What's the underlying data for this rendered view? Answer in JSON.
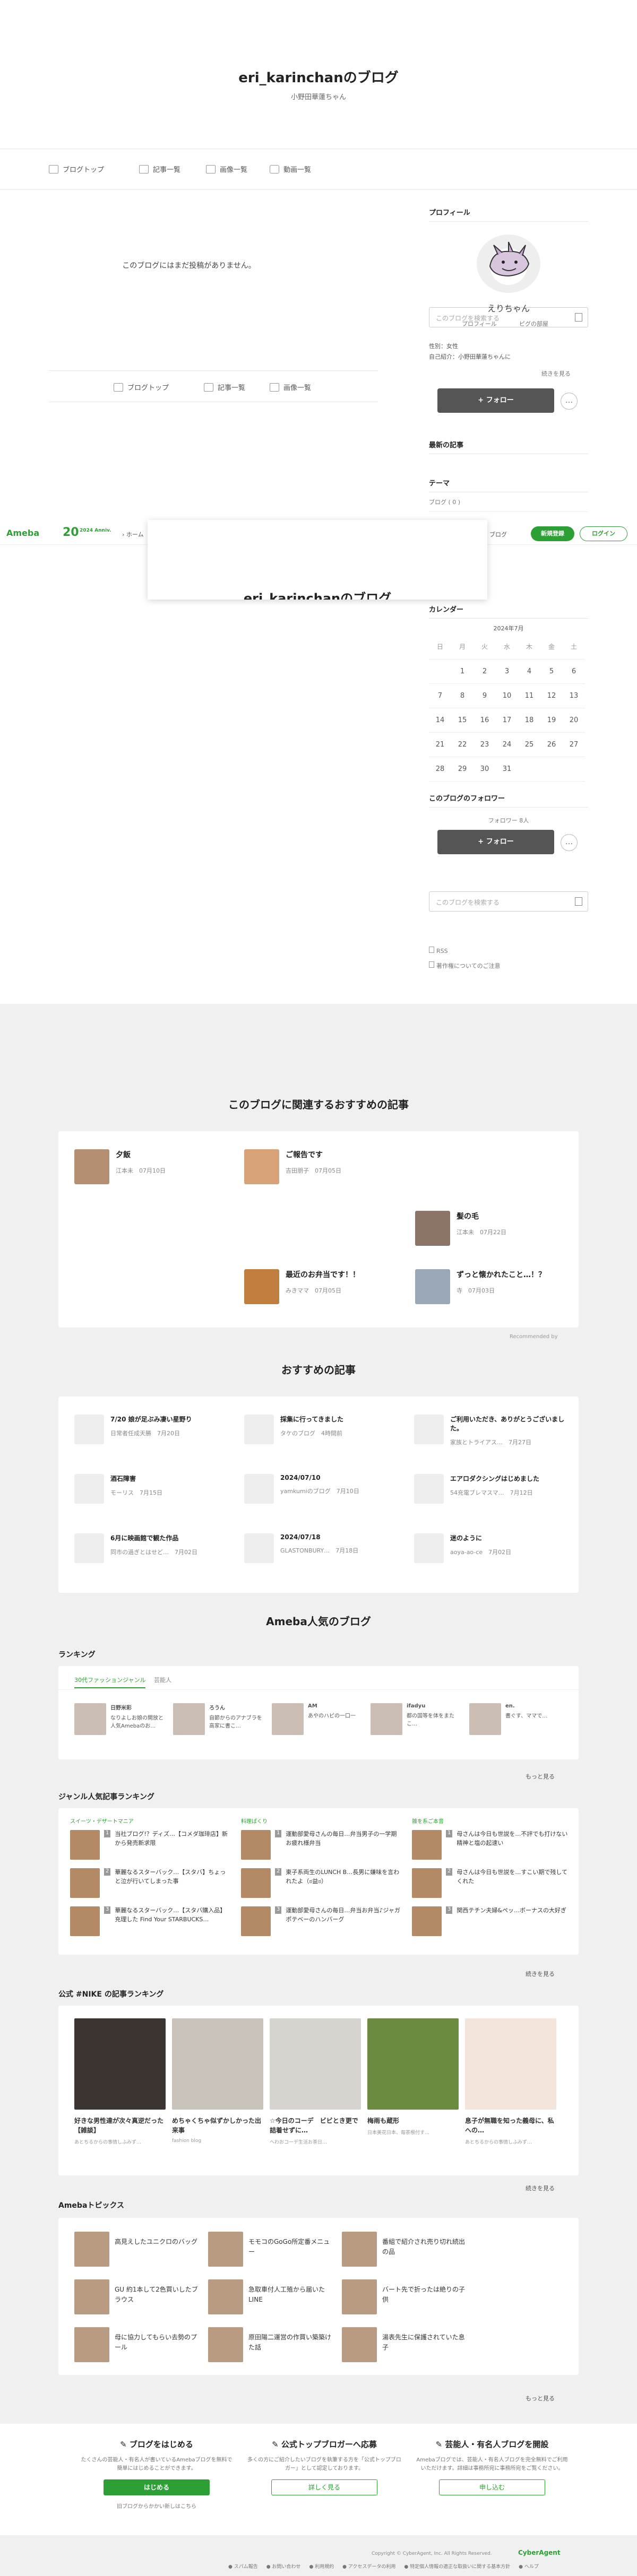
{
  "blog": {
    "title": "eri_karinchanのブログ",
    "subtitle": "小野田華蓮ちゃん"
  },
  "nav": {
    "items": [
      "ブログトップ",
      "記事一覧",
      "画像一覧",
      "動画一覧"
    ],
    "search_placeholder": "このブログを検索する"
  },
  "main": {
    "empty": "このブログにはまだ投稿がありません。",
    "subnav": [
      "ブログトップ",
      "記事一覧",
      "画像一覧"
    ]
  },
  "ameba_bar": {
    "logo": "Ameba",
    "anniv": "20",
    "anniv_sub": "2024 Anniv.",
    "home": "ホーム",
    "myblog": "ブログ",
    "register": "新規登録",
    "login": "ログイン",
    "overlay_title": "eri_karinchanのブログ"
  },
  "side": {
    "profile": {
      "title": "プロフィール",
      "name": "えりちゃん",
      "links": [
        "プロフィール",
        "ピグの部屋"
      ],
      "gender": "性別：女性",
      "intro": "自己紹介：小野田華蓮ちゃんに",
      "more": "続きを見る",
      "follow": "+ フォロー",
      "more_icon": "…"
    },
    "latest": {
      "title": "最新の記事"
    },
    "theme": {
      "title": "テーマ",
      "item": "ブログ ( 0 )"
    },
    "calendar": {
      "title": "カレンダー",
      "month": "2024年7月",
      "days": [
        "日",
        "月",
        "火",
        "水",
        "木",
        "金",
        "土"
      ],
      "weeks": [
        [
          "",
          "1",
          "2",
          "3",
          "4",
          "5",
          "6"
        ],
        [
          "7",
          "8",
          "9",
          "10",
          "11",
          "12",
          "13"
        ],
        [
          "14",
          "15",
          "16",
          "17",
          "18",
          "19",
          "20"
        ],
        [
          "21",
          "22",
          "23",
          "24",
          "25",
          "26",
          "27"
        ],
        [
          "28",
          "29",
          "30",
          "31",
          "",
          "",
          ""
        ]
      ]
    },
    "followers": {
      "title": "このブログのフォロワー",
      "count": "フォロワー 8人",
      "follow": "+ フォロー"
    },
    "search_placeholder": "このブログを検索する",
    "rss": "RSS",
    "copyright": "著作権についてのご注意"
  },
  "related": {
    "title": "このブログに関連するおすすめの記事",
    "items": [
      {
        "title": "夕飯",
        "author": "江本未",
        "date": "07月10日"
      },
      {
        "title": "ご報告です",
        "author": "吉田朋子",
        "date": "07月05日"
      },
      {
        "title": "髪の毛",
        "author": "江本未",
        "date": "07月22日"
      },
      {
        "title": "最近のお弁当です！！",
        "author": "みきママ",
        "date": "07月05日"
      },
      {
        "title": "ずっと懐かれたこと…！？",
        "author": "寺",
        "date": "07月03日"
      }
    ],
    "credit": "Recommended by"
  },
  "recommend": {
    "title": "おすすめの記事",
    "items": [
      {
        "title": "7/20 娘が足ぶみ凄い星野り",
        "meta": "日常者任成天勝　7月20日"
      },
      {
        "title": "採集に行ってきました",
        "meta": "タケのブログ　4時間前"
      },
      {
        "title": "ご利用いただき、ありがとうございました。",
        "meta": "家族とトライアス…　7月27日"
      },
      {
        "title": "酒石障害",
        "meta": "モーリス　7月15日"
      },
      {
        "title": "2024/07/10",
        "meta": "yamkumiのブログ　7月10日"
      },
      {
        "title": "エアロダクシングはじめました",
        "meta": "54充電ブレマスマ…　7月12日"
      },
      {
        "title": "6月に映画館で観た作品",
        "meta": "同市の過ぎとはせど…　7月02日"
      },
      {
        "title": "2024/07/18",
        "meta": "GLASTONBURY…　7月18日"
      },
      {
        "title": "迷のように",
        "meta": "aoya-ao-ce　7月02日"
      }
    ]
  },
  "popular": {
    "title": "Ameba人気のブログ",
    "ranking_label": "ランキング",
    "tabs": [
      "30代ファッションジャンル",
      "芸能人"
    ],
    "users": [
      {
        "name": "日野米彩",
        "desc": "なりよしお娘の開放と人気Amebaのお…"
      },
      {
        "name": "ろうん",
        "desc": "自節からのアナブラを高家に書こ…"
      },
      {
        "name": "AM",
        "desc": "あやのハピの一口一"
      },
      {
        "name": "ifadyu",
        "desc": "都の国等を体をまたこ…"
      },
      {
        "name": "en.",
        "desc": "書ぐす、ママで…"
      }
    ],
    "more": "もっと見る"
  },
  "genre": {
    "title": "ジャンル人気記事ランキング",
    "cols": [
      {
        "label": "スイーツ・デザートマニア",
        "items": [
          "当社ブログ!？ディズ…【コメダ珈琲店】新から発売新求限",
          "華麗なるスターバック…【スタバ】ちょっと泣が行いてしまった事",
          "華麗なるスターバック…【スタバ購入品】充理した Find Your STARBUCKS…"
        ]
      },
      {
        "label": "料理ぱくり",
        "items": [
          "運動部愛母さんの毎日…弁当男子の一学期お疲れ様弁当",
          "東子系両生のLUNCH B…長男に嫌味を言われたよ（ಠ益ಠ）",
          "運動部愛母さんの毎日…弁当お弁当♪ジャガポテベーのハンバーグ"
        ]
      },
      {
        "label": "雑を系ご本音",
        "items": [
          "母さんは今日も世説を…不評でも打けない精神と塩の起速い",
          "母さんは今日も世説を…すこい期で残してくれた",
          "関西テチン夫婦&ペッ…ボーナスの大好ぎ"
        ]
      }
    ],
    "more": "続きを見る"
  },
  "nike": {
    "title": "公式 #NIKE の記事ランキング",
    "items": [
      {
        "title": "好きな男性達が次々真逆だった【雑談】",
        "meta": "あとちるからの事情しふみず…"
      },
      {
        "title": "めちゃくちゃ似ずかしかった出来事",
        "meta": "fashion blog"
      },
      {
        "title": "☆今日のコーデ　ビビとき更で詰着せずに…",
        "meta": "ヘわおコーデ生活お茶日…"
      },
      {
        "title": "梅雨も蔵形",
        "meta": "日本美花日本、毎茶根付す…"
      },
      {
        "title": "息子が無職を知った義母に、私への…",
        "meta": "あとちるからの事情しふみず…"
      }
    ],
    "more": "続きを見る"
  },
  "topics": {
    "title": "Amebaトピックス",
    "items": [
      "高見えしたユニクロのバッグ",
      "モモコのGoGo所定番メニュー",
      "番組で紹介され売り切れ続出の品",
      "GU 約1本して2色買いしたブラウス",
      "急取車付人工殖から届いたLINE",
      "バート先で折ったは絶りの子供",
      "母に協力してもらい去勢のプール",
      "原田陽二運営の作買い築築けた話",
      "湯表先生に保護されていた息子"
    ],
    "more": "もっと見る"
  },
  "cta": [
    {
      "title": "ブログをはじめる",
      "desc": "たくさんの芸能人・有名人が書いているAmebaブログを無料で簡単にはじめることができます。",
      "btn": "はじめる",
      "link": "旧ブログからかかい新しはこちら"
    },
    {
      "title": "公式トップブロガーへ応募",
      "desc": "多くの方にご紹介したいブログを執筆する方を「公式トップブロガー」として認定しております。",
      "btn": "詳しく見る",
      "link": ""
    },
    {
      "title": "芸能人・有名人ブログを開設",
      "desc": "Amebaブログでは、芸能人・有名人ブログを完全無料でご利用いただけます。詳細は事務所宛に事務所宛をご覧ください。",
      "btn": "申し込む",
      "link": ""
    }
  ],
  "footer": {
    "copyright": "Copyright © CyberAgent, Inc. All Rights Reserved.",
    "brand": "CyberAgent",
    "links": [
      "スパム報告",
      "お問い合わせ",
      "利用規約",
      "アクセスデータの利用",
      "特定個人情報の適正な取扱いに関する基本方針",
      "ヘルプ"
    ]
  },
  "colors": {
    "accent_green": "#2ca034",
    "dark_button": "#555555",
    "grey_bg": "#f0f0f0"
  }
}
